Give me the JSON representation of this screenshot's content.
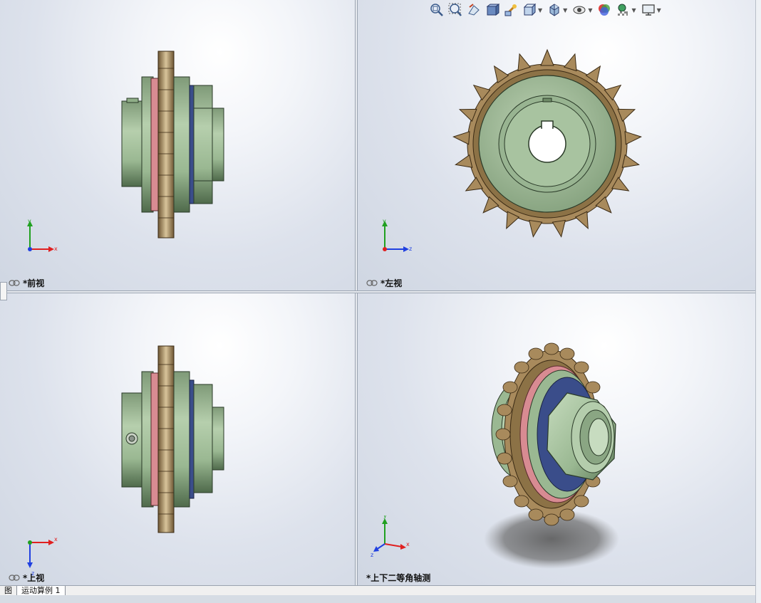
{
  "viewports": [
    {
      "label": "*前视",
      "axes": [
        "y",
        "x"
      ]
    },
    {
      "label": "*左视",
      "axes": [
        "y",
        "z"
      ]
    },
    {
      "label": "*上视",
      "axes": [
        "x",
        "z"
      ]
    },
    {
      "label": "*上下二等角轴测",
      "axes": [
        "y",
        "x",
        "z"
      ]
    }
  ],
  "toolbar": {
    "icons": [
      "zoom-to-fit-icon",
      "zoom-to-area-icon",
      "previous-view-icon",
      "section-view-icon",
      "dynamic-annotation-icon",
      "view-orientation-icon",
      "display-style-icon",
      "hide-show-items-icon",
      "edit-appearance-icon",
      "apply-scene-icon",
      "view-settings-icon"
    ]
  },
  "bottom_tabs": [
    "图",
    "运动算例 1"
  ],
  "colors": {
    "part_green": "#9ab892",
    "sprocket_bronze": "#a88a5c",
    "seal_pink": "#d88b92",
    "axis_x": "#e02020",
    "axis_y": "#20a020",
    "axis_z": "#2040e0"
  }
}
